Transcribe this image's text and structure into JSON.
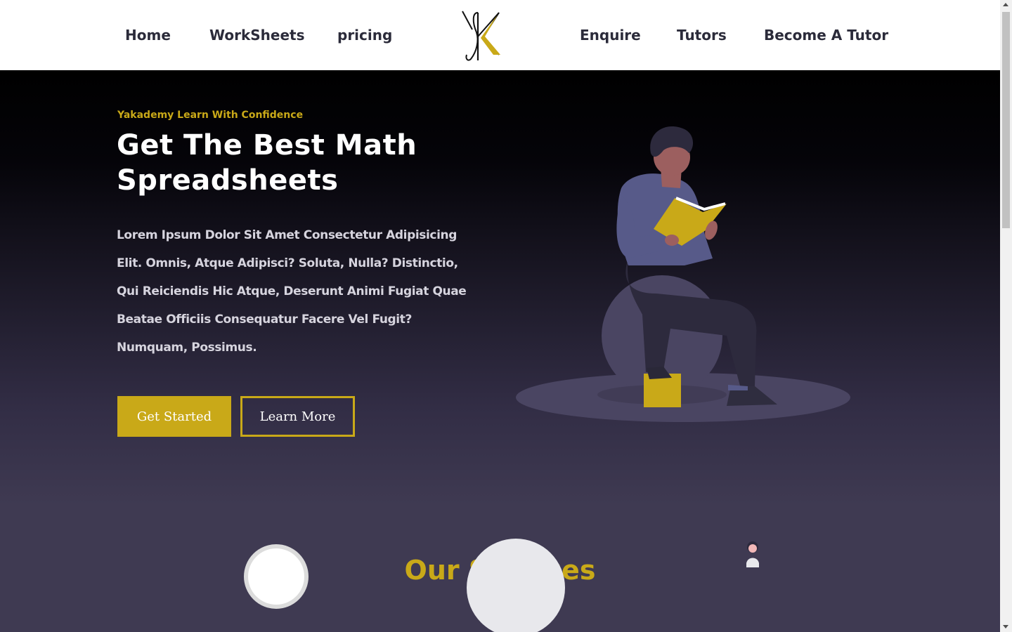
{
  "nav": {
    "left_links": [
      "Home",
      "WorkSheets",
      "pricing"
    ],
    "right_links": [
      "Enquire",
      "Tutors",
      "Become A Tutor"
    ]
  },
  "hero": {
    "tagline": "Yakademy Learn With Confidence",
    "headline": "Get The Best Math Spreadsheets",
    "body": "Lorem Ipsum Dolor Sit Amet Consectetur Adipisicing Elit. Omnis, Atque Adipisci? Soluta, Nulla? Distinctio, Qui Reiciendis Hic Atque, Deserunt Animi Fugiat Quae Beatae Officiis Consequatur Facere Vel Fugit? Numquam, Possimus.",
    "primary_button": "Get Started",
    "secondary_button": "Learn More"
  },
  "services": {
    "title": "Our Services"
  },
  "colors": {
    "accent": "#c9a918",
    "dark": "#000000",
    "purple": "#3f3a52",
    "shirt": "#575a89"
  }
}
